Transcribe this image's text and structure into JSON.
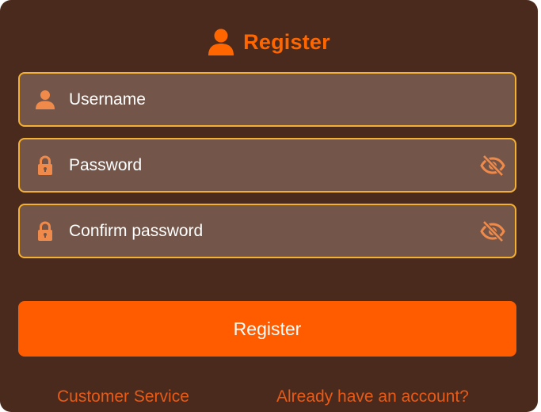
{
  "header": {
    "title": "Register",
    "icon": "user-icon"
  },
  "form": {
    "username": {
      "placeholder": "Username",
      "value": "",
      "icon": "user-icon"
    },
    "password": {
      "placeholder": "Password",
      "value": "",
      "icon": "lock-icon",
      "toggle_icon": "eye-slash-icon"
    },
    "confirm_password": {
      "placeholder": "Confirm password",
      "value": "",
      "icon": "lock-icon",
      "toggle_icon": "eye-slash-icon"
    }
  },
  "submit_label": "Register",
  "footer": {
    "customer_service": "Customer Service",
    "login_link": "Already have an account?"
  },
  "colors": {
    "panel_bg": "#4a2a1c",
    "accent": "#ff6600",
    "button_bg": "#ff5c00",
    "field_bg": "#735649",
    "field_border": "#f4b032",
    "link": "#e85a16",
    "icon": "#f08a4a"
  }
}
